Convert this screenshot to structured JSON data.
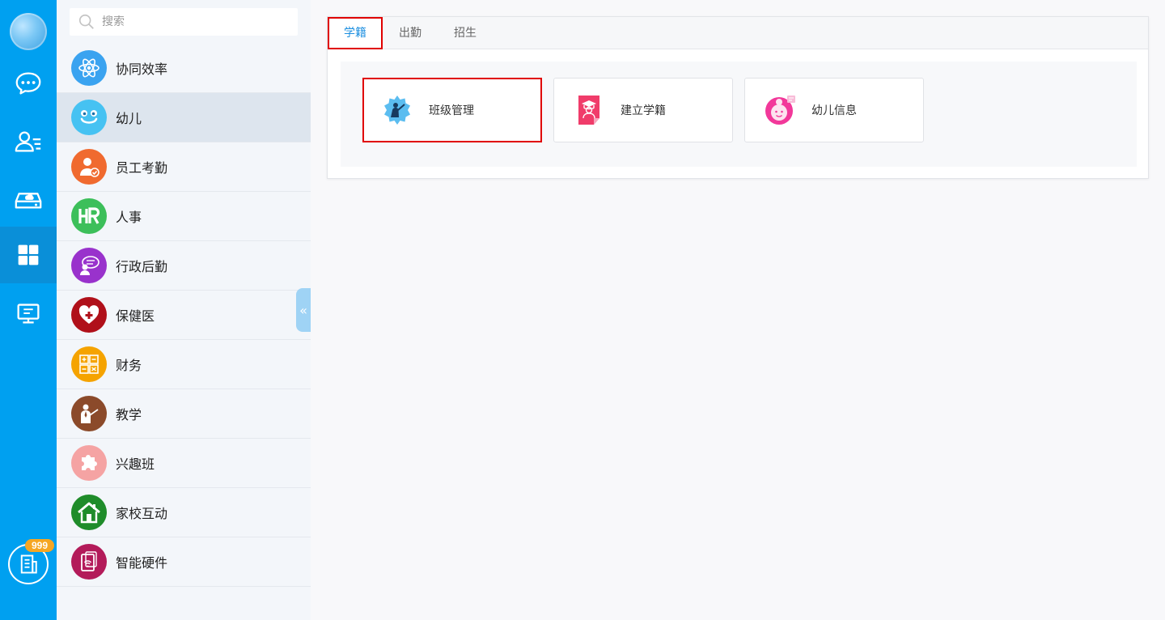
{
  "rail": {
    "icons": [
      "avatar-icon",
      "chat-icon",
      "contacts-icon",
      "cloud-drive-icon",
      "apps-grid-icon",
      "monitor-icon",
      "building-icon"
    ],
    "badge": "999",
    "accent": "#00a0f0"
  },
  "search": {
    "placeholder": "搜索"
  },
  "sidebar": {
    "items": [
      {
        "label": "协同效率",
        "icon": "atom-icon",
        "color": "#3aa3f0"
      },
      {
        "label": "幼儿",
        "icon": "smiley-icon",
        "color": "#46c2f2"
      },
      {
        "label": "员工考勤",
        "icon": "employee-check-icon",
        "color": "#f06a2f"
      },
      {
        "label": "人事",
        "icon": "hr-icon",
        "color": "#3cbf5a"
      },
      {
        "label": "行政后勤",
        "icon": "admin-icon",
        "color": "#9932cc"
      },
      {
        "label": "保健医",
        "icon": "health-heart-icon",
        "color": "#b0101a"
      },
      {
        "label": "财务",
        "icon": "calculator-icon",
        "color": "#f5a300"
      },
      {
        "label": "教学",
        "icon": "teacher-icon",
        "color": "#8b4a2a"
      },
      {
        "label": "兴趣班",
        "icon": "puzzle-icon",
        "color": "#f5a3a3"
      },
      {
        "label": "家校互动",
        "icon": "house-icon",
        "color": "#1f8c2a"
      },
      {
        "label": "智能硬件",
        "icon": "smart-device-icon",
        "color": "#b31b5a"
      }
    ]
  },
  "main": {
    "tabs": [
      {
        "label": "学籍"
      },
      {
        "label": "出勤"
      },
      {
        "label": "招生"
      }
    ],
    "cards": [
      {
        "label": "班级管理",
        "icon": "class-gear-icon"
      },
      {
        "label": "建立学籍",
        "icon": "student-record-icon"
      },
      {
        "label": "幼儿信息",
        "icon": "child-info-icon"
      }
    ]
  }
}
